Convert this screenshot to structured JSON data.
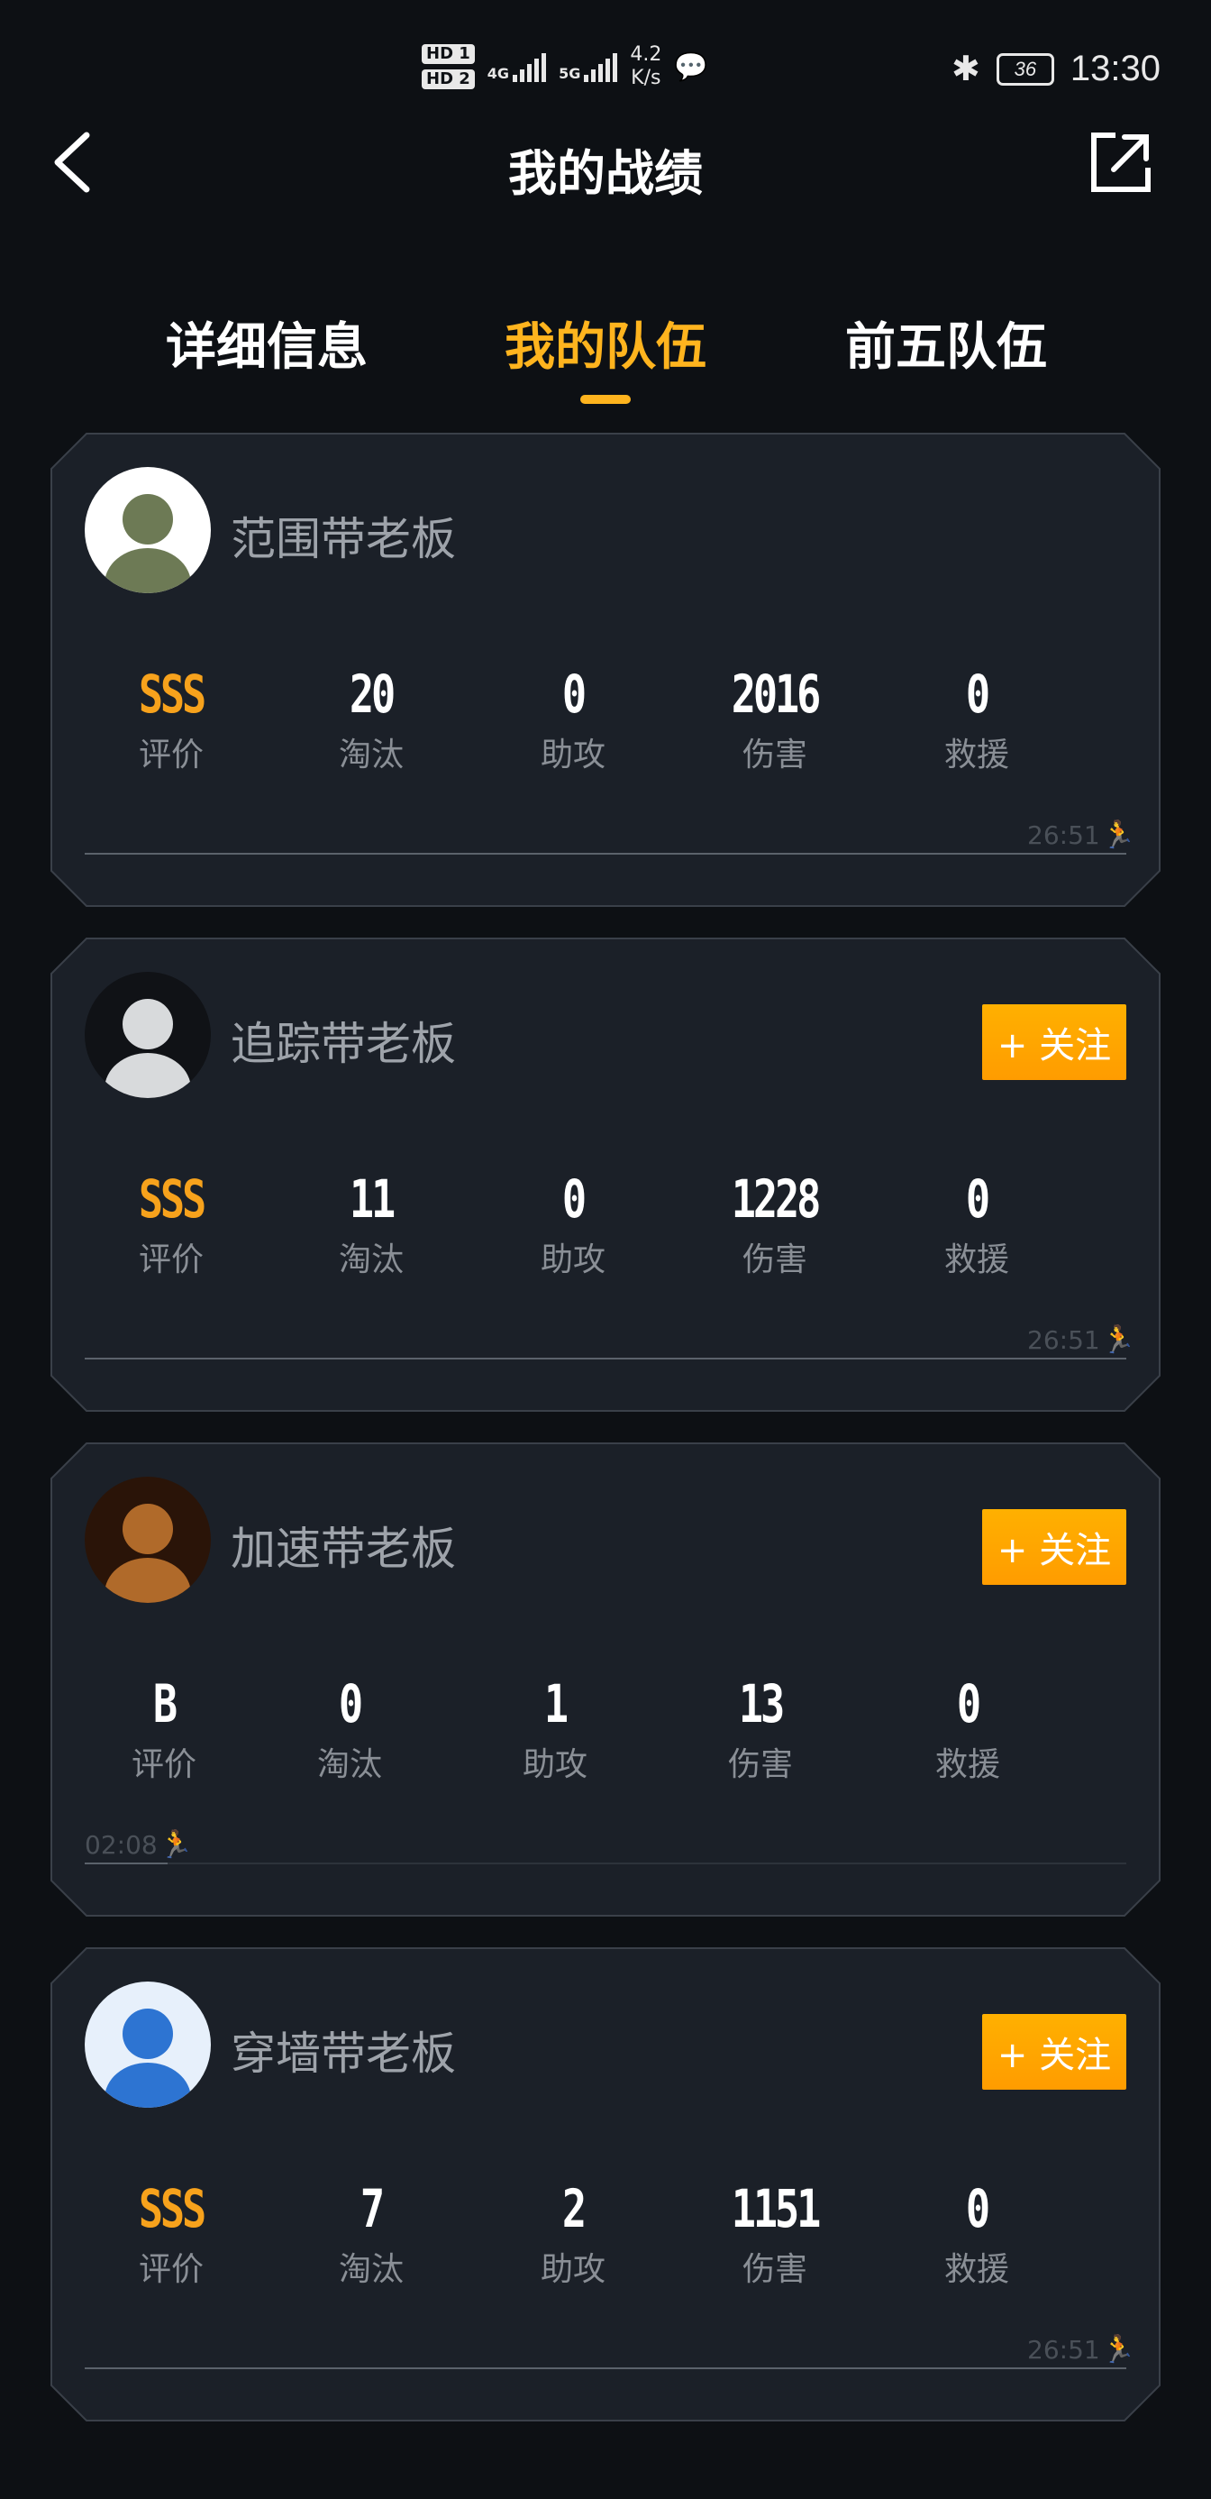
{
  "status_bar": {
    "hd1": "HD 1",
    "hd2": "HD 2",
    "net1": "4G",
    "net2": "5G",
    "speed_value": "4.2",
    "speed_unit": "K/s",
    "battery": "36",
    "time": "13:30"
  },
  "header": {
    "title": "我的战绩"
  },
  "tabs": [
    {
      "label": "详细信息"
    },
    {
      "label": "我的队伍"
    },
    {
      "label": "前五队伍"
    }
  ],
  "active_tab": "我的队伍",
  "colors": {
    "accent": "#ffb41e",
    "rating": "#f7a21c",
    "card_bg": "#1b2028",
    "follow_bg": "#ffa500"
  },
  "stat_labels": {
    "rating": "评价",
    "kills": "淘汰",
    "assists": "助攻",
    "damage": "伤害",
    "rescue": "救援"
  },
  "players": [
    {
      "name": "范围带老板",
      "rating": "SSS",
      "kills": "20",
      "assists": "0",
      "damage": "2016",
      "rescue": "0",
      "time": "26:51",
      "follow_label": "",
      "survival_fraction": 1.0
    },
    {
      "name": "追踪带老板",
      "rating": "SSS",
      "kills": "11",
      "assists": "0",
      "damage": "1228",
      "rescue": "0",
      "time": "26:51",
      "follow_label": "+ 关注",
      "survival_fraction": 1.0
    },
    {
      "name": "加速带老板",
      "rating": "B",
      "kills": "0",
      "assists": "1",
      "damage": "13",
      "rescue": "0",
      "time": "02:08",
      "follow_label": "+ 关注",
      "survival_fraction": 0.08
    },
    {
      "name": "穿墙带老板",
      "rating": "SSS",
      "kills": "7",
      "assists": "2",
      "damage": "1151",
      "rescue": "0",
      "time": "26:51",
      "follow_label": "+ 关注",
      "survival_fraction": 1.0
    }
  ]
}
